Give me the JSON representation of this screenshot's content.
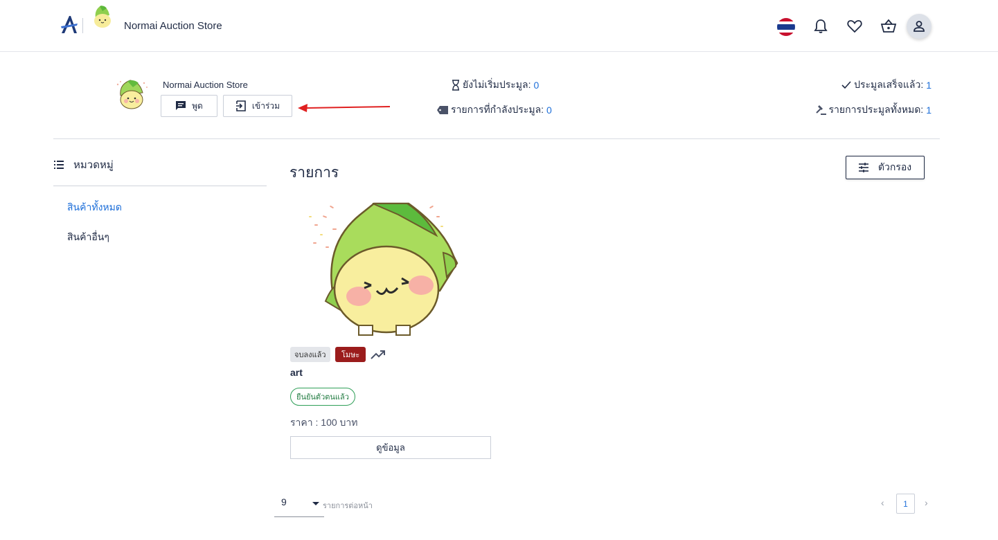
{
  "header": {
    "brand_name": "Normai Auction Store",
    "icons": [
      "thailand-flag",
      "bell-icon",
      "heart-icon",
      "basket-icon",
      "user-icon"
    ]
  },
  "store": {
    "name": "Normai Auction Store",
    "chat_label": "พูด",
    "join_label": "เข้าร่วม"
  },
  "stats": {
    "not_started_label": "ยังไม่เริ่มประมูล:",
    "not_started_value": "0",
    "in_progress_label": "รายการที่กำลังประมูล:",
    "in_progress_value": "0",
    "completed_label": "ประมูลเสร็จแล้ว:",
    "completed_value": "1",
    "total_label": "รายการประมูลทั้งหมด:",
    "total_value": "1"
  },
  "sidebar": {
    "title": "หมวดหมู่",
    "items": [
      {
        "label": "สินค้าทั้งหมด",
        "active": true
      },
      {
        "label": "สินค้าอื่นๆ",
        "active": false
      }
    ]
  },
  "main": {
    "title": "รายการ",
    "filter_label": "ตัวกรอง"
  },
  "product": {
    "status_chip": "จบลงแล้ว",
    "type_chip": "โมษะ",
    "name": "art",
    "verified_label": "ยืนยันตัวตนแล้ว",
    "price": "ราคา : 100 บาท",
    "detail_label": "ดูข้อมูล"
  },
  "pagination": {
    "per_page_value": "9",
    "per_page_label": "รายการต่อหน้า",
    "current_page": "1"
  },
  "colors": {
    "primary_text": "#1f2a44",
    "accent_blue": "#1e6fd9",
    "chip_red": "#9b1c1c",
    "verified_green": "#2e9e57",
    "annotation_arrow": "#e02020"
  }
}
